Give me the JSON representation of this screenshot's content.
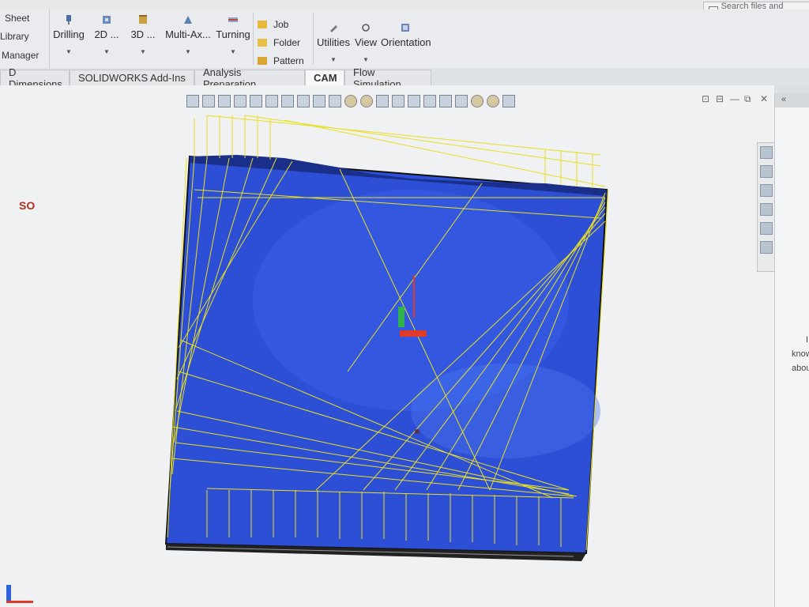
{
  "search": {
    "placeholder": "Search files and models"
  },
  "ribbon": {
    "left_items": [
      "Sheet",
      "Library",
      "Manager"
    ],
    "buttons": [
      "Drilling",
      "2D ...",
      "3D ...",
      "Multi-Ax...",
      "Turning"
    ],
    "small_items": [
      "Job",
      "Folder",
      "Pattern"
    ],
    "right_buttons": [
      "Utilities",
      "View",
      "Orientation"
    ]
  },
  "tabs": [
    "D Dimensions",
    "SOLIDWORKS Add-Ins",
    "Analysis Preparation",
    "CAM",
    "Flow Simulation"
  ],
  "active_tab": "CAM",
  "window_controls": [
    "⊡",
    "⊟",
    "—",
    "⧉",
    "✕"
  ],
  "task_pane": {
    "collapse": "«",
    "title": "SO",
    "lines": [
      "I",
      "know",
      "abou"
    ]
  },
  "colors": {
    "part_surface": "#2d4fd6",
    "toolpath": "#e8e021",
    "axis_x": "#e03a2a",
    "axis_y": "#2fb34a",
    "axis_z": "#2f62d8"
  },
  "icons": [
    "search-icon",
    "drilling-icon",
    "2d-icon",
    "3d-icon",
    "multiaxis-icon",
    "turning-icon",
    "job-icon",
    "folder-icon",
    "pattern-icon",
    "utilities-icon",
    "view-icon",
    "orientation-icon"
  ]
}
